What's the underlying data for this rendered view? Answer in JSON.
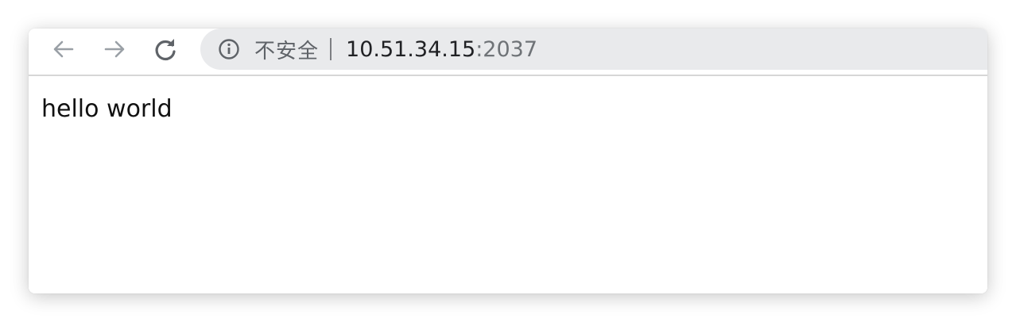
{
  "browser": {
    "nav": {
      "back_icon": "arrow-left-icon",
      "forward_icon": "arrow-right-icon",
      "reload_icon": "reload-icon"
    },
    "address_bar": {
      "info_icon": "info-icon",
      "security_label": "不安全",
      "url_host": "10.51.34.15",
      "url_port": ":2037"
    }
  },
  "page": {
    "body_text": "hello world"
  },
  "colors": {
    "omnibox_bg": "#e9eaec",
    "icon_disabled": "#9aa0a6",
    "icon_enabled": "#5f6368",
    "text": "#202124"
  }
}
